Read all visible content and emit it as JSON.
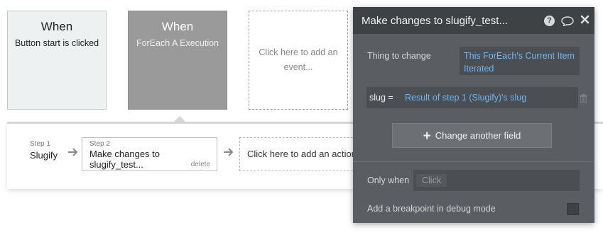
{
  "events": [
    {
      "title": "When",
      "subtitle": "Button start is clicked"
    },
    {
      "title": "When",
      "subtitle": "ForEach A Execution"
    },
    {
      "placeholder": "Click here to add an event..."
    }
  ],
  "workflow": {
    "step1": {
      "label": "Step 1",
      "name": "Slugify"
    },
    "step2": {
      "label": "Step 2",
      "name": "Make changes to slugify_test...",
      "delete": "delete"
    },
    "add_action": "Click here to add an action"
  },
  "panel": {
    "title": "Make changes to slugify_test...",
    "help_glyph": "?",
    "thing_label": "Thing to change",
    "thing_value": "This ForEach's Current Item Iterated",
    "field_key": "slug =",
    "field_value": "Result of step 1 (Slugify)'s slug",
    "change_button": "Change another field",
    "only_when_label": "Only when",
    "only_when_value": "Click",
    "breakpoint_label": "Add a breakpoint in debug mode"
  },
  "colors": {
    "panel_bg": "#5a5d61",
    "header_bg": "#3f4245",
    "link_blue": "#6fb6f2",
    "selected_event": "#9a9a9a"
  },
  "icons": [
    "help-icon",
    "comment-icon",
    "close-icon",
    "trash-icon",
    "arrow-right-icon",
    "plus-icon"
  ]
}
